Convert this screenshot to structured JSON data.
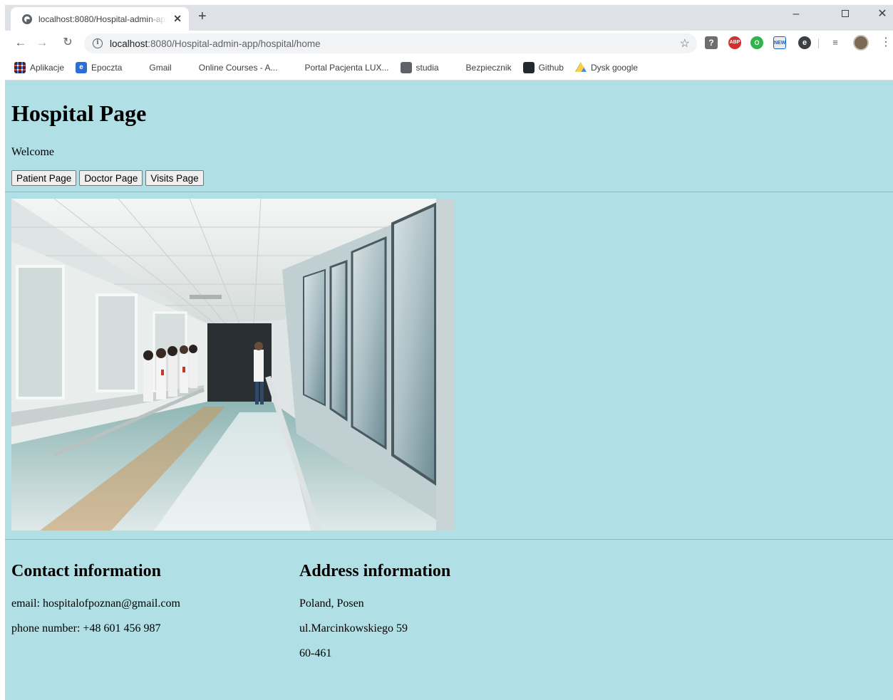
{
  "browser": {
    "tab_title": "localhost:8080/Hospital-admin-app",
    "url_host": "localhost",
    "url_rest": ":8080/Hospital-admin-app/hospital/home",
    "bookmarks": [
      {
        "label": "Aplikacje",
        "icon": "apps-grid-icon"
      },
      {
        "label": "Epoczta",
        "icon": "epoczta-icon"
      },
      {
        "label": "Gmail",
        "icon": "gmail-icon"
      },
      {
        "label": "Online Courses - A...",
        "icon": "udemy-icon"
      },
      {
        "label": "Portal Pacjenta LUX...",
        "icon": "luxmed-icon"
      },
      {
        "label": "studia",
        "icon": "globe-icon"
      },
      {
        "label": "Bezpiecznik",
        "icon": "bezpiecznik-icon"
      },
      {
        "label": "Github",
        "icon": "github-icon"
      },
      {
        "label": "Dysk google",
        "icon": "google-drive-icon"
      }
    ]
  },
  "page": {
    "title": "Hospital Page",
    "welcome": "Welcome",
    "buttons": {
      "patient": "Patient Page",
      "doctor": "Doctor Page",
      "visits": "Visits Page"
    },
    "background_color": "#b0dfe5",
    "contact": {
      "title": "Contact information",
      "email": "email: hospitalofpoznan@gmail.com",
      "phone": "phone number: +48 601 456 987"
    },
    "address": {
      "title": "Address information",
      "line1": "Poland, Posen",
      "line2": "ul.Marcinkowskiego 59",
      "line3": "60-461"
    }
  }
}
